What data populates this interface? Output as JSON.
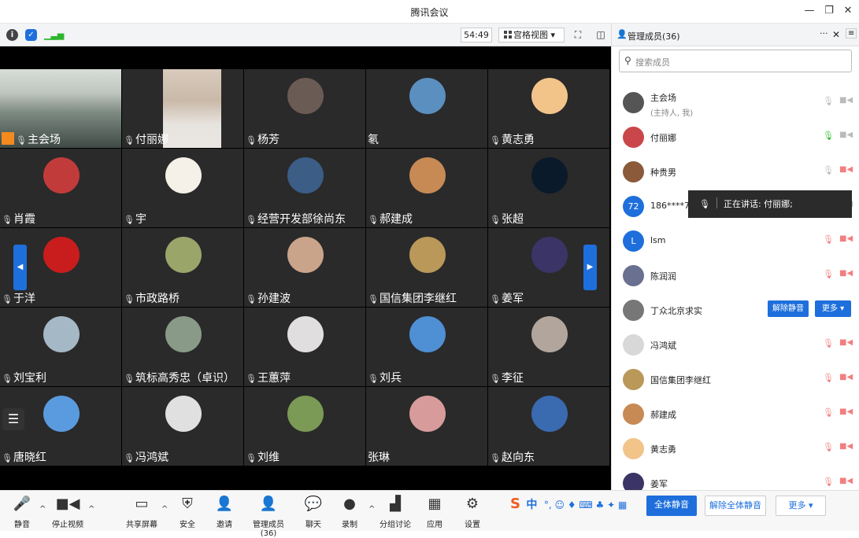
{
  "app": {
    "title": "腾讯会议"
  },
  "meeting_bar": {
    "timer": "54:49",
    "view_label": "宫格视图"
  },
  "tiles": [
    {
      "name": "主会场",
      "type": "photo-room",
      "host": true
    },
    {
      "name": "付丽娜",
      "type": "photo-lady"
    },
    {
      "name": "杨芳",
      "color": "#6b5b55"
    },
    {
      "name": "氡",
      "color": "#5a8fc0",
      "nomic": true
    },
    {
      "name": "黄志勇",
      "color": "#f2c48a"
    },
    {
      "name": "肖霞",
      "color": "#c23b3b"
    },
    {
      "name": "宇",
      "color": "#f5f0e8"
    },
    {
      "name": "经营开发部徐尚东",
      "color": "#3b5d86"
    },
    {
      "name": "郝建成",
      "color": "#c78a55"
    },
    {
      "name": "张超",
      "color": "#0a1a2a"
    },
    {
      "name": "于洋",
      "color": "#c91d1d"
    },
    {
      "name": "市政路桥",
      "color": "#9aa56a"
    },
    {
      "name": "孙建波",
      "color": "#caa48a"
    },
    {
      "name": "国信集团李继红",
      "color": "#b9985a"
    },
    {
      "name": "姜军",
      "color": "#3a3566"
    },
    {
      "name": "刘宝利",
      "color": "#a5b8c5"
    },
    {
      "name": "筑标高秀忠（卓识）",
      "color": "#8a9a88"
    },
    {
      "name": "王蕙萍",
      "color": "#e0dede"
    },
    {
      "name": "刘兵",
      "color": "#4f8fd4"
    },
    {
      "name": "李征",
      "color": "#b2a69c"
    },
    {
      "name": "唐晓红",
      "color": "#5a9be0"
    },
    {
      "name": "冯鸿斌",
      "color": "#e0e0e0"
    },
    {
      "name": "刘维",
      "color": "#7a9a55"
    },
    {
      "name": "张琳",
      "color": "#d89b9b",
      "nomic": true
    },
    {
      "name": "赵向东",
      "color": "#3a6ab0"
    }
  ],
  "panel": {
    "title": "管理成员(36)",
    "search_placeholder": "搜索成员",
    "tooltip": "正在讲话: 付丽娜;",
    "members": [
      {
        "name": "主会场",
        "sub": "(主持人, 我)",
        "avatar_color": "#555",
        "mic": "off"
      },
      {
        "name": "付丽娜",
        "avatar_color": "#c9474a",
        "mic": "on"
      },
      {
        "name": "种贵男",
        "avatar_color": "#8a5a3a",
        "mic": "off",
        "cam": "red"
      },
      {
        "name": "186****70",
        "avatar_text": "72",
        "avatar_color": "#1e6fdc",
        "mic": "off"
      },
      {
        "name": "lsm",
        "avatar_text": "L",
        "avatar_color": "#1e6fdc",
        "mic": "red"
      },
      {
        "name": "陈润润",
        "avatar_color": "#6a7090",
        "mic": "red"
      },
      {
        "name": "丁众北京求实",
        "avatar_color": "#777",
        "actions": true
      },
      {
        "name": "冯鸿斌",
        "avatar_color": "#d8d8d8",
        "mic": "red"
      },
      {
        "name": "国信集团李继红",
        "avatar_color": "#b9985a",
        "mic": "red"
      },
      {
        "name": "郝建成",
        "avatar_color": "#c78a55",
        "mic": "red"
      },
      {
        "name": "黄志勇",
        "avatar_color": "#f2c48a",
        "mic": "red"
      },
      {
        "name": "姜军",
        "avatar_color": "#3a3566",
        "mic": "red"
      }
    ],
    "unmute_label": "解除静音",
    "more_label": "更多 ▾",
    "mute_all": "全体静音",
    "unmute_all": "解除全体静音",
    "more_bottom": "更多 ▾"
  },
  "toolbar": {
    "mute": "静音",
    "video": "停止视频",
    "share": "共享屏幕",
    "security": "安全",
    "invite": "邀请",
    "members": "管理成员(36)",
    "chat": "聊天",
    "record": "录制",
    "breakout": "分组讨论",
    "apps": "应用",
    "settings": "设置"
  },
  "ime": {
    "label": "中"
  }
}
